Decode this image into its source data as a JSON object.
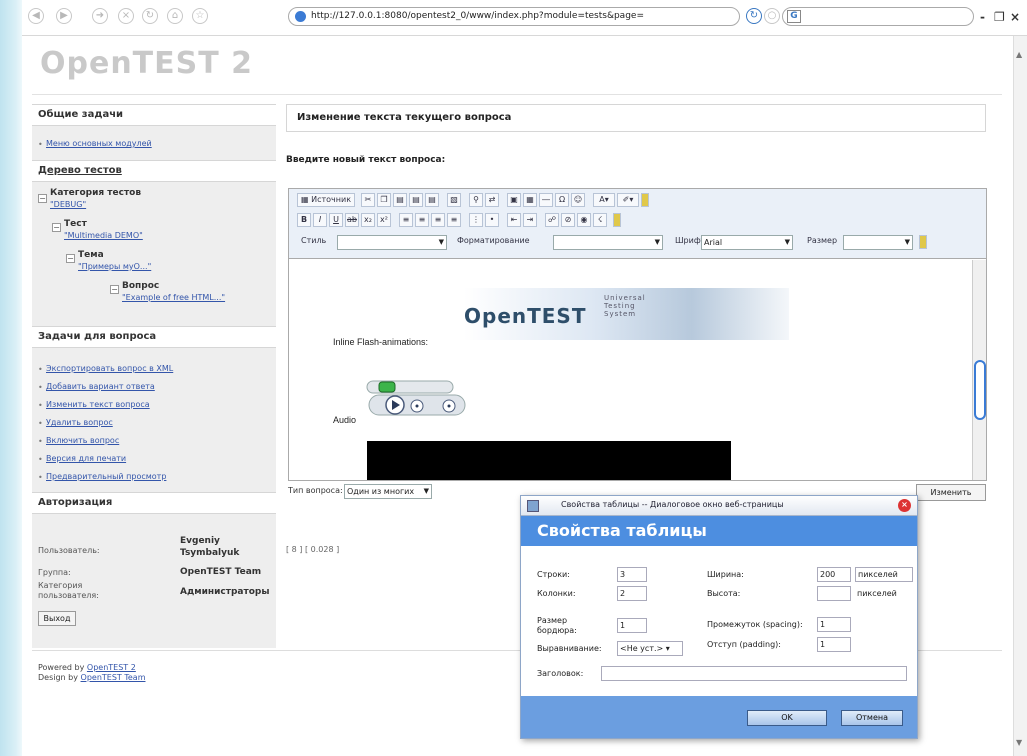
{
  "browser": {
    "url": "http://127.0.0.1:8080/opentest2_0/www/index.php?module=tests&page=",
    "search_engine": "G",
    "window_controls": [
      "-",
      "❐",
      "×"
    ]
  },
  "site": {
    "logo": "OpenTEST 2"
  },
  "sidebar": {
    "general_tasks": {
      "title": "Общие задачи",
      "links": [
        "Меню основных модулей"
      ]
    },
    "test_tree": {
      "title": "Дерево тестов",
      "nodes": [
        {
          "label": "Категория тестов",
          "link": "\"DEBUG\""
        },
        {
          "label": "Тест",
          "link": "\"Multimedia DEMO\""
        },
        {
          "label": "Тема",
          "link": "\"Примеры муО...\""
        },
        {
          "label": "Вопрос",
          "link": "\"Example of free HTML...\""
        }
      ]
    },
    "question_tasks": {
      "title": "Задачи для вопроса",
      "links": [
        "Экспортировать вопрос в XML",
        "Добавить вариант ответа",
        "Изменить текст вопроса",
        "Удалить вопрос",
        "Включить вопрос",
        "Версия для печати",
        "Предварительный просмотр"
      ]
    },
    "auth": {
      "title": "Авторизация",
      "user_label": "Пользователь:",
      "user_first": "Evgeniy",
      "user_last": "Tsymbalyuk",
      "group_label": "Группа:",
      "group_value": "OpenTEST Team",
      "category_label_1": "Категория",
      "category_label_2": "пользователя:",
      "category_value": "Администраторы",
      "logout": "Выход"
    }
  },
  "main": {
    "header": "Изменение текста текущего вопроса",
    "prompt": "Введите новый текст вопроса:",
    "editor": {
      "source_btn": "Источник",
      "style_label": "Стиль",
      "format_label": "Форматирование",
      "font_label": "Шрифт",
      "font_value": "Arial",
      "size_label": "Размер",
      "flash_label": "Inline Flash-animations:",
      "audio_label": "Audio",
      "banner_title": "OpenTEST",
      "banner_sub_1": "Universal",
      "banner_sub_2": "Testing",
      "banner_sub_3": "System"
    },
    "question_type_label": "Тип вопроса:",
    "question_type_value": "Один из многих",
    "change_btn": "Изменить",
    "timing": "[ 8 ] [ 0.028 ]"
  },
  "footer": {
    "powered_prefix": "Powered by ",
    "powered_link": "OpenTEST 2",
    "design_prefix": "Design by ",
    "design_link": "OpenTEST Team"
  },
  "dialog": {
    "title": "Свойства таблицы -- Диалоговое окно веб-страницы",
    "heading": "Свойства таблицы",
    "rows_label": "Строки:",
    "rows_value": "3",
    "cols_label": "Колонки:",
    "cols_value": "2",
    "width_label": "Ширина:",
    "width_value": "200",
    "width_unit": "пикселей",
    "height_label": "Высота:",
    "height_value": "",
    "height_unit": "пикселей",
    "border_label_1": "Размер",
    "border_label_2": "бордюра:",
    "border_value": "1",
    "spacing_label": "Промежуток (spacing):",
    "spacing_value": "1",
    "align_label": "Выравнивание:",
    "align_value": "<Не уст.>",
    "padding_label": "Отступ (padding):",
    "padding_value": "1",
    "caption_label": "Заголовок:",
    "caption_value": "",
    "ok": "OK",
    "cancel": "Отмена"
  }
}
